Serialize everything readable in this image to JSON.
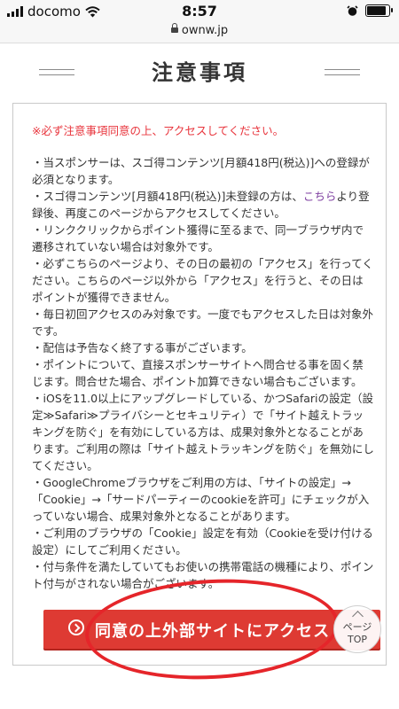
{
  "status_bar": {
    "carrier": "docomo",
    "time": "8:57",
    "icons": [
      "signal-bars-icon",
      "wifi-icon",
      "alarm-clock-icon",
      "battery-icon"
    ]
  },
  "url_bar": {
    "domain": "ownw.jp"
  },
  "page": {
    "title": "注意事項"
  },
  "notice": {
    "warning": "※必ず注意事項同意の上、アクセスしてください。",
    "items": [
      "当スポンサーは、スゴ得コンテンツ[月額418円(税込)]への登録が必須となります。",
      {
        "before": "スゴ得コンテンツ[月額418円(税込)]未登録の方は、",
        "link": "こちら",
        "after": "より登録後、再度このページからアクセスしてください。"
      },
      "リンククリックからポイント獲得に至るまで、同一ブラウザ内で遷移されていない場合は対象外です。",
      "必ずこちらのページより、その日の最初の「アクセス」を行ってください。こちらのページ以外から「アクセス」を行うと、その日はポイントが獲得できません。",
      "毎日初回アクセスのみ対象です。一度でもアクセスした日は対象外です。",
      "配信は予告なく終了する事がございます。",
      "ポイントについて、直接スポンサーサイトへ問合せる事を固く禁じます。問合せた場合、ポイント加算できない場合もございます。",
      "iOSを11.0以上にアップグレードしている、かつSafariの設定（設定≫Safari≫プライバシーとセキュリティ）で「サイト越えトラッキングを防ぐ」を有効にしている方は、成果対象外となることがあります。ご利用の際は「サイト越えトラッキングを防ぐ」を無効にしてください。",
      "GoogleChromeブラウザをご利用の方は、「サイトの設定」→「Cookie」→「サードパーティーのcookieを許可」にチェックが入っていない場合、成果対象外となることがあります。",
      "ご利用のブラウザの「Cookie」設定を有効（Cookieを受け付ける設定）にしてご利用ください。",
      "付与条件を満たしていてもお使いの携帯電話の機種により、ポイント付与がされない場合がございます。"
    ]
  },
  "cta": {
    "label": "同意の上外部サイトにアクセス"
  },
  "page_top": {
    "line1": "ページ",
    "line2": "TOP"
  },
  "colors": {
    "accent": "#de3a33",
    "warning_text": "#e8343c",
    "link": "#7e3fa0",
    "annotation": "#e5252a"
  }
}
